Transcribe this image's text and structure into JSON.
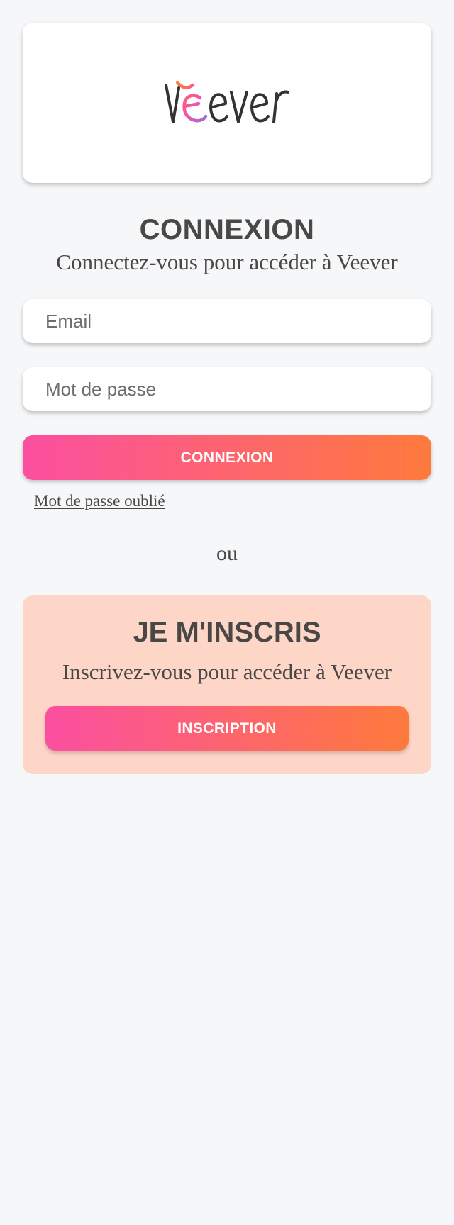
{
  "brand": {
    "logo_text": "Veever",
    "accent_gradient": [
      "#fc4fa1",
      "#fe7a3c"
    ],
    "signup_bg": "#fed6c8"
  },
  "login": {
    "title": "CONNEXION",
    "subtitle": "Connectez-vous pour accéder à Veever",
    "email_placeholder": "Email",
    "password_placeholder": "Mot de passe",
    "submit_label": "CONNEXION",
    "forgot_label": "Mot de passe oublié"
  },
  "separator": "ou",
  "signup": {
    "title": "JE M'INSCRIS",
    "subtitle": "Inscrivez-vous pour accéder à Veever",
    "button_label": "INSCRIPTION"
  }
}
